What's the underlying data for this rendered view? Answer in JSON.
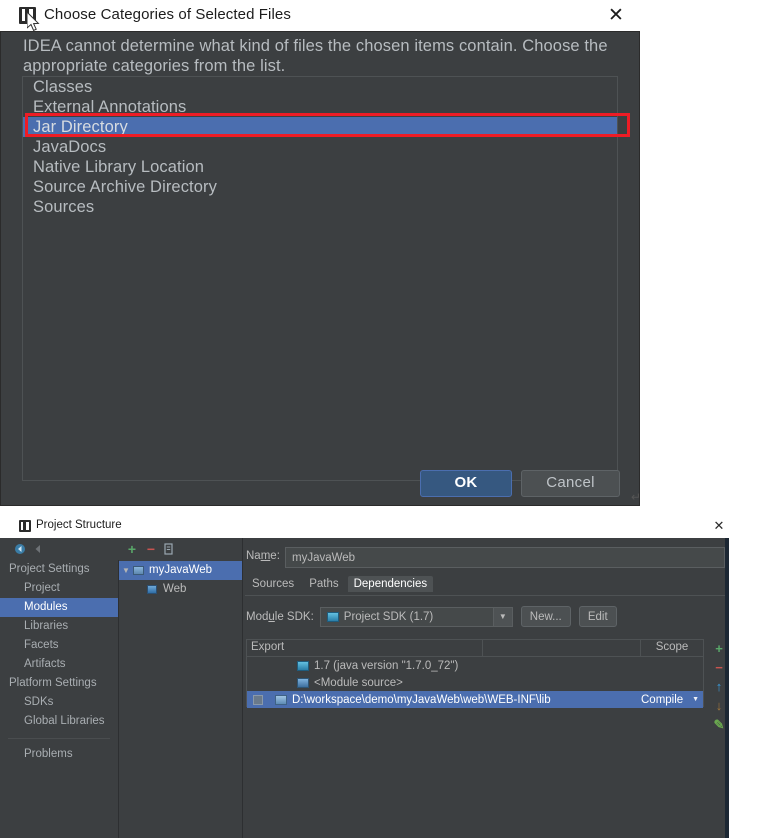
{
  "dialog1": {
    "title": "Choose Categories of Selected Files",
    "app_icon": "intellij-idea-icon",
    "close_label": "✕",
    "message": "IDEA cannot determine what kind of files the chosen items contain. Choose the appropriate categories from the list.",
    "categories": [
      "Classes",
      "External Annotations",
      "Jar Directory",
      "JavaDocs",
      "Native Library Location",
      "Source Archive Directory",
      "Sources"
    ],
    "selected_category": "Jar Directory",
    "selected_index": 2,
    "annotation": {
      "type": "rectangle-highlight",
      "color": "#ee1c25",
      "target": "Jar Directory"
    },
    "buttons": {
      "ok": "OK",
      "cancel": "Cancel"
    },
    "pilcrow": "↵"
  },
  "dialog2": {
    "title": "Project Structure",
    "app_icon": "intellij-idea-icon",
    "close_label": "✕",
    "sidebar": {
      "groups": [
        {
          "label": "Project Settings",
          "items": [
            "Project",
            "Modules",
            "Libraries",
            "Facets",
            "Artifacts"
          ]
        },
        {
          "label": "Platform Settings",
          "items": [
            "SDKs",
            "Global Libraries"
          ]
        }
      ],
      "footer_items": [
        "Problems"
      ],
      "active_item": "Modules"
    },
    "module_panel": {
      "toolbar": [
        {
          "name": "add-module-button",
          "glyph": "+",
          "color": "#59a869"
        },
        {
          "name": "remove-module-button",
          "glyph": "−",
          "color": "#c75450"
        },
        {
          "name": "copy-module-button",
          "glyph": "❐",
          "color": "#9aa7b0"
        }
      ],
      "tree": [
        {
          "label": "myJavaWeb",
          "icon": "module-icon",
          "expanded": true,
          "selected": true,
          "depth": 0
        },
        {
          "label": "Web",
          "icon": "web-facet-icon",
          "expanded": false,
          "selected": false,
          "depth": 1
        }
      ]
    },
    "content": {
      "name_label": "Name:",
      "name_value": "myJavaWeb",
      "tabs": [
        {
          "label": "Sources",
          "active": false
        },
        {
          "label": "Paths",
          "active": false
        },
        {
          "label": "Dependencies",
          "active": true
        }
      ],
      "sdk_label": "Module SDK:",
      "sdk_value": "Project SDK (1.7)",
      "sdk_buttons": {
        "new": "New...",
        "edit": "Edit"
      },
      "table": {
        "headers": {
          "export": "Export",
          "scope": "Scope"
        },
        "rows": [
          {
            "checked": false,
            "icon": "sdk-icon",
            "label": "1.7 (java version \"1.7.0_72\")",
            "scope": "",
            "selected": false,
            "show_checkbox": false
          },
          {
            "checked": false,
            "icon": "module-source-icon",
            "label": "<Module source>",
            "scope": "",
            "selected": false,
            "show_checkbox": false
          },
          {
            "checked": true,
            "icon": "folder-icon",
            "label": "D:\\workspace\\demo\\myJavaWeb\\web\\WEB-INF\\lib",
            "scope": "Compile",
            "selected": true,
            "show_checkbox": true
          }
        ]
      },
      "table_tools": [
        {
          "name": "add-dependency-button",
          "glyph": "+",
          "color": "#59a869"
        },
        {
          "name": "remove-dependency-button",
          "glyph": "−",
          "color": "#c75450"
        },
        {
          "name": "move-up-button",
          "glyph": "↑",
          "color": "#3a9ad9"
        },
        {
          "name": "move-down-button",
          "glyph": "↓",
          "color": "#a2763a"
        },
        {
          "name": "edit-dependency-button",
          "glyph": "✎",
          "color": "#6aa84f"
        }
      ]
    }
  }
}
